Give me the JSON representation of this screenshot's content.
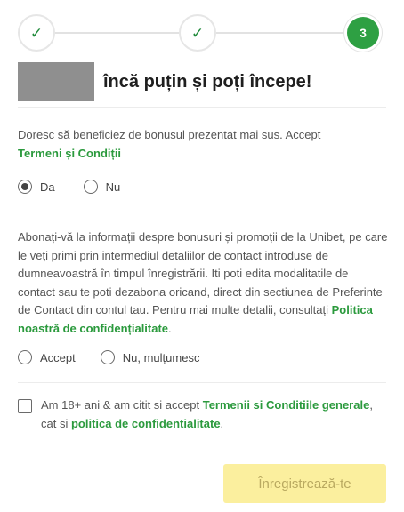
{
  "stepper": {
    "step1_icon": "check-icon",
    "step2_icon": "check-icon",
    "step3_number": "3"
  },
  "heading": {
    "text": "încă puțin și poți începe!"
  },
  "bonus": {
    "text": "Doresc să beneficiez de bonusul prezentat mai sus. Accept ",
    "link": "Termeni și Condiții",
    "option_yes": "Da",
    "option_no": "Nu",
    "selected": "Da"
  },
  "promotions": {
    "text": "Abonați-vă la informații despre bonusuri și promoții de la Unibet, pe care le veți primi prin intermediul detaliilor de contact introduse de dumneavoastră în timpul înregistrării. Iti poti edita modalitatile de contact sau te poti dezabona oricand, direct din sectiunea de Preferinte de Contact din contul tau. Pentru mai multe detalii, consultați ",
    "link": "Politica noastră de confidențialitate",
    "text_end": ".",
    "option_accept": "Accept",
    "option_decline": "Nu, mulțumesc"
  },
  "terms": {
    "text_start": "Am 18+ ani & am citit si accept ",
    "link_terms": "Termenii si Conditiile generale",
    "text_middle": ", cat si ",
    "link_privacy": "politica de confidentialitate",
    "text_end": "."
  },
  "register_button": {
    "label": "Înregistrează-te"
  },
  "colors": {
    "accent_green": "#2ea043",
    "link_green": "#2b9a3d",
    "button_disabled": "#fbef9e"
  }
}
